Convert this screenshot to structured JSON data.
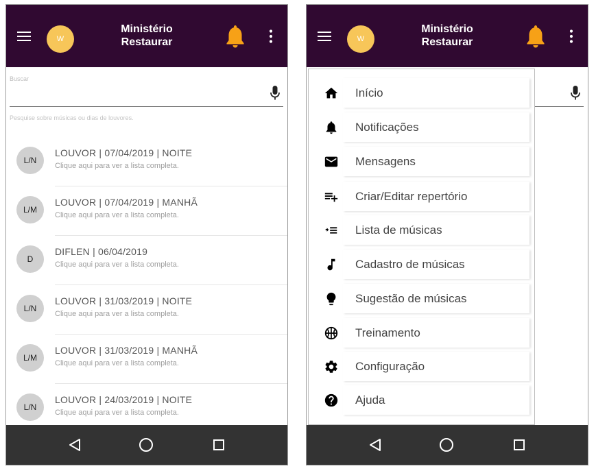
{
  "app": {
    "title_line1": "Ministério",
    "title_line2": "Restaurar",
    "avatar_letter": "W",
    "appbar_color": "#300931",
    "avatar_color": "#f7c659",
    "bell_color": "#f7a117"
  },
  "search": {
    "label": "Buscar",
    "value": "",
    "hint": "Pesquise sobre músicas ou dias de louvores."
  },
  "list": [
    {
      "initials": "L/N",
      "title": "LOUVOR | 07/04/2019 | NOITE",
      "subtitle": "Clique aqui para ver a lista completa."
    },
    {
      "initials": "L/M",
      "title": "LOUVOR | 07/04/2019 | MANHÃ",
      "subtitle": "Clique aqui para ver a lista completa."
    },
    {
      "initials": "D",
      "title": "DIFLEN | 06/04/2019",
      "subtitle": "Clique aqui para ver a lista completa."
    },
    {
      "initials": "L/N",
      "title": "LOUVOR | 31/03/2019 | NOITE",
      "subtitle": "Clique aqui para ver a lista completa."
    },
    {
      "initials": "L/M",
      "title": "LOUVOR | 31/03/2019 | MANHÃ",
      "subtitle": "Clique aqui para ver a lista completa."
    },
    {
      "initials": "L/N",
      "title": "LOUVOR | 24/03/2019 | NOITE",
      "subtitle": "Clique aqui para ver a lista completa."
    }
  ],
  "drawer": [
    {
      "icon": "home-icon",
      "label": "Início"
    },
    {
      "icon": "bell-icon",
      "label": "Notificações"
    },
    {
      "icon": "mail-icon",
      "label": "Mensagens"
    },
    {
      "icon": "playlist-add-icon",
      "label": "Criar/Editar repertório"
    },
    {
      "icon": "playlist-play-icon",
      "label": "Lista de músicas"
    },
    {
      "icon": "music-note-icon",
      "label": "Cadastro de músicas"
    },
    {
      "icon": "lightbulb-icon",
      "label": "Sugestão de músicas"
    },
    {
      "icon": "basketball-icon",
      "label": "Treinamento"
    },
    {
      "icon": "gear-icon",
      "label": "Configuração"
    },
    {
      "icon": "help-icon",
      "label": "Ajuda"
    }
  ]
}
